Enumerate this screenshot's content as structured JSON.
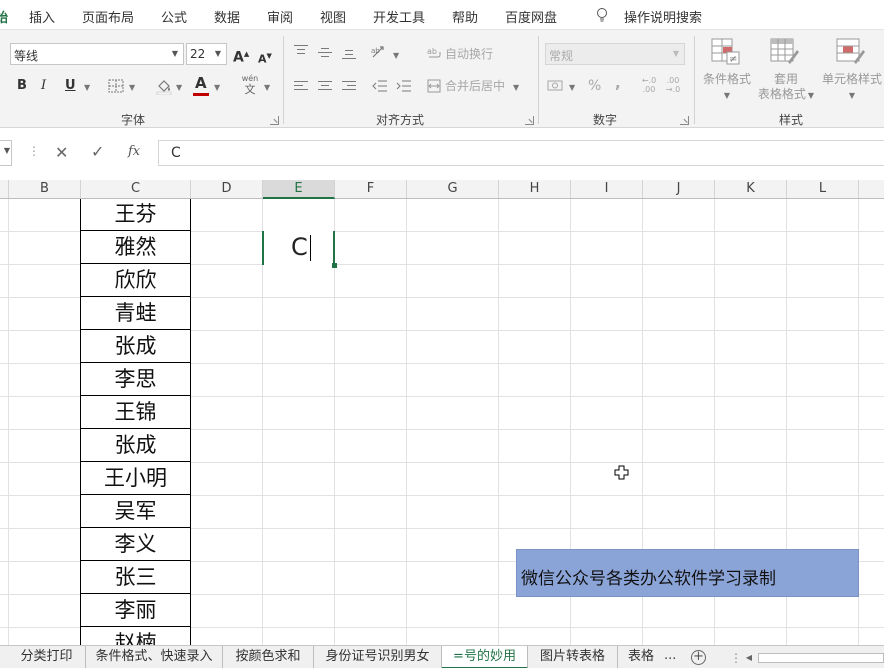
{
  "menu": {
    "active_partial": "始",
    "items": [
      "插入",
      "页面布局",
      "公式",
      "数据",
      "审阅",
      "视图",
      "开发工具",
      "帮助",
      "百度网盘"
    ],
    "search": "操作说明搜索"
  },
  "ribbon": {
    "font": {
      "name": "等线",
      "size": "22",
      "grow": "A",
      "shrink": "A",
      "bold": "B",
      "italic": "I",
      "underline": "U",
      "font_color_letter": "A",
      "font_color": "#c00000",
      "phonetic_top": "wén",
      "phonetic_bottom": "文",
      "label": "字体"
    },
    "alignment": {
      "wrap_text": "自动换行",
      "merge_center": "合并后居中",
      "label": "对齐方式"
    },
    "number": {
      "format": "常规",
      "percent": "%",
      "comma": ",",
      "inc_decimal": "←.0 .00",
      "dec_decimal": ".00 →.0",
      "label": "数字"
    },
    "styles": {
      "conditional_format": "条件格式",
      "table_format_1": "套用",
      "table_format_2": "表格格式",
      "cell_styles": "单元格样式",
      "label": "样式"
    }
  },
  "formula_bar": {
    "dots": "⋮",
    "cancel": "✕",
    "enter": "✓",
    "fx": "fx",
    "content": "C"
  },
  "columns": [
    "B",
    "C",
    "D",
    "E",
    "F",
    "G",
    "H",
    "I",
    "J",
    "K",
    "L"
  ],
  "selected_column": "E",
  "names": [
    "王芬",
    "雅然",
    "欣欣",
    "青蛙",
    "张成",
    "李思",
    "王锦",
    "张成",
    "王小明",
    "吴军",
    "李义",
    "张三",
    "李丽",
    "赵楠"
  ],
  "edit_cell": {
    "text": "C"
  },
  "banner": {
    "text": "微信公众号各类办公软件学习录制",
    "color": "#8ba4d8"
  },
  "sheet_tabs": [
    "分类打印",
    "条件格式、快速录入",
    "按颜色求和",
    "身份证号识别男女",
    "=号的妙用",
    "图片转表格",
    "表格"
  ],
  "active_tab": "=号的妙用",
  "tab_more": "...",
  "tab_add": "+",
  "tab_sep": "⋮",
  "accent_color": "#217346"
}
